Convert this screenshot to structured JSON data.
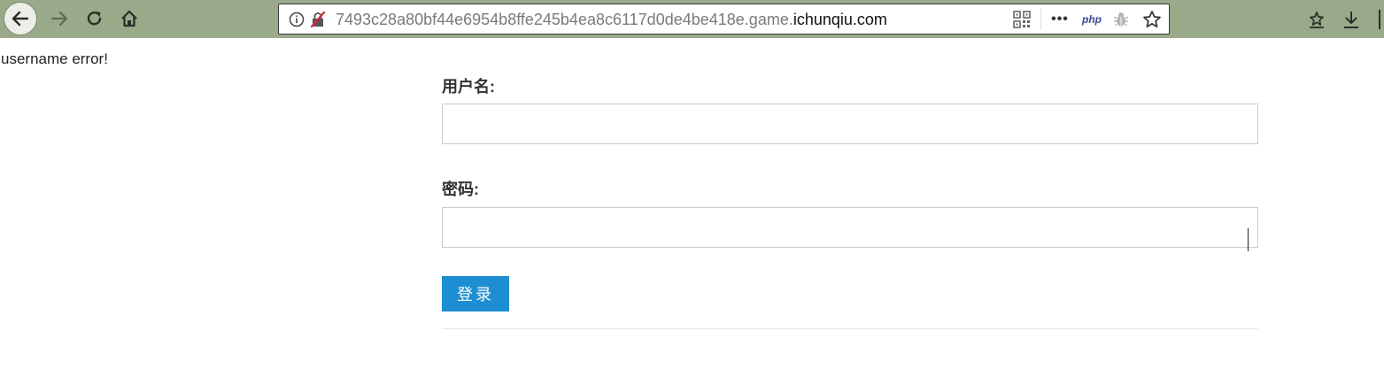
{
  "browser": {
    "url_prefix": "7493c28a80bf44e6954b8ffe245b4ea8c6117d0de4be418e.game.",
    "url_domain": "ichunqiu.com",
    "more_label": "•••",
    "php_label": "php",
    "accent_color": "#9aa98a"
  },
  "page": {
    "error_message": "username error!",
    "username_label": "用户名:",
    "password_label": "密码:",
    "username_value": "",
    "password_value": "",
    "login_button": "登录",
    "button_color": "#1d8ed1"
  }
}
